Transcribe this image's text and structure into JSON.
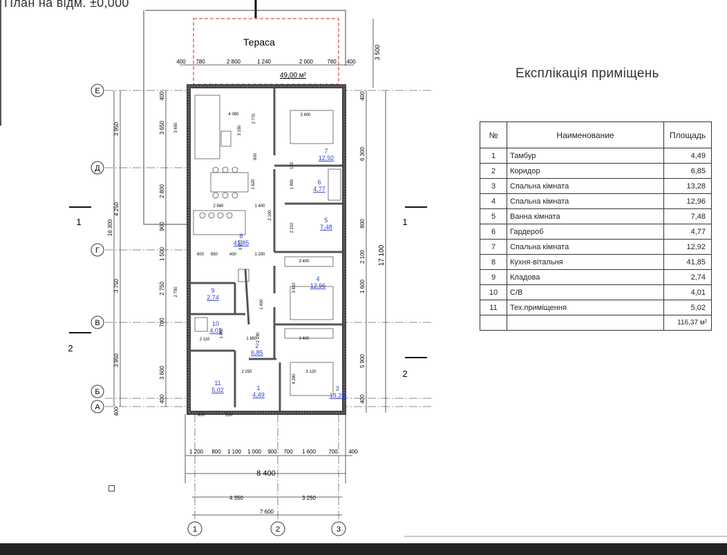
{
  "plan": {
    "title": "План на відм. ±0,000",
    "terrace": {
      "label": "Тераса",
      "area": "49,00 м²"
    },
    "terrace_dims": [
      "400",
      "780",
      "2 800",
      "1 240",
      "2 000",
      "780",
      "400"
    ],
    "terrace_depth": "3 500",
    "axes_letters": [
      "Е",
      "Д",
      "Г",
      "В",
      "Б",
      "А"
    ],
    "axes_numbers": [
      "1",
      "2",
      "3"
    ],
    "section_labels": [
      "1",
      "1",
      "2",
      "2"
    ],
    "left_dims_outer": [
      "3 950",
      "4 250",
      "3 750",
      "3 950",
      "400"
    ],
    "left_total": "16 300",
    "left_dims_inner": [
      "400",
      "3 650",
      "2 800",
      "900",
      "1 500",
      "2 750",
      "700",
      "3 600",
      "400"
    ],
    "right_dims": [
      "400",
      "6 300",
      "800",
      "2 100",
      "1 600",
      "5 900",
      "400"
    ],
    "right_total": "17 100",
    "bottom_dims": [
      "1 200",
      "800",
      "1 100",
      "1 000",
      "900",
      "700",
      "1 600",
      "700",
      "400"
    ],
    "overall_width": "8 400",
    "axis_spans": [
      "4 350",
      "3 250"
    ],
    "axis_total": "7 600",
    "inner_dims": [
      "4 080",
      "3 400",
      "2 770",
      "900",
      "1 620",
      "3 650",
      "3 150",
      "2 680",
      "1 400",
      "2 100",
      "850",
      "430",
      "600",
      "1 200",
      "3 510",
      "120",
      "2 210",
      "1 800",
      "3 400",
      "3 810",
      "2 750",
      "1 400",
      "2 110",
      "1 860",
      "1 850",
      "2 240",
      "2 250",
      "4 280",
      "3 120",
      "3 400",
      "800",
      "510"
    ],
    "rooms": [
      {
        "no": "7",
        "area": "12,92"
      },
      {
        "no": "6",
        "area": "4,77"
      },
      {
        "no": "5",
        "area": "7,48"
      },
      {
        "no": "8",
        "area": "41,85"
      },
      {
        "no": "4",
        "area": "12,96"
      },
      {
        "no": "9",
        "area": "2,74"
      },
      {
        "no": "10",
        "area": "4,01"
      },
      {
        "no": "2",
        "area": "6,85"
      },
      {
        "no": "11",
        "area": "5,02"
      },
      {
        "no": "1",
        "area": "4,49"
      },
      {
        "no": "3",
        "area": "13,28"
      }
    ]
  },
  "explication": {
    "title": "Експлікація приміщень",
    "headers": {
      "no": "№",
      "name": "Наименование",
      "area": "Площадь"
    },
    "rows": [
      {
        "no": "1",
        "name": "Тамбур",
        "area": "4,49"
      },
      {
        "no": "2",
        "name": "Коридор",
        "area": "6,85"
      },
      {
        "no": "3",
        "name": "Спальна кімната",
        "area": "13,28"
      },
      {
        "no": "4",
        "name": "Спальна кімната",
        "area": "12,96"
      },
      {
        "no": "5",
        "name": "Ванна кімната",
        "area": "7,48"
      },
      {
        "no": "6",
        "name": "Гардероб",
        "area": "4,77"
      },
      {
        "no": "7",
        "name": "Спальна кімната",
        "area": "12,92"
      },
      {
        "no": "8",
        "name": "Кухня-вітальня",
        "area": "41,85"
      },
      {
        "no": "9",
        "name": "Кладова",
        "area": "2,74"
      },
      {
        "no": "10",
        "name": "С/В",
        "area": "4,01"
      },
      {
        "no": "11",
        "name": "Тех.приміщення",
        "area": "5,02"
      }
    ],
    "total": "116,37 м²"
  },
  "colors": {
    "room_label": "#2a3fd6",
    "wall": "#444444",
    "line": "#333333",
    "terrace_outline": "#cc2222"
  }
}
